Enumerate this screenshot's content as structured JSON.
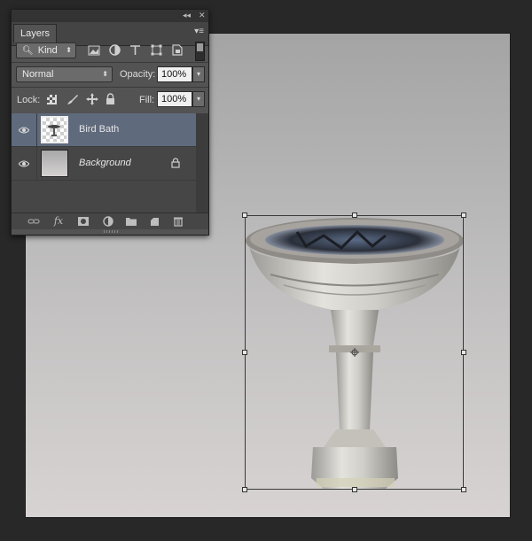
{
  "panel": {
    "tab_label": "Layers",
    "collapse_glyph": "◂◂",
    "close_glyph": "✕",
    "menu_glyph": "▾≡"
  },
  "filter": {
    "kind_label": "Kind",
    "icons": [
      "image-filter-icon",
      "adjustment-filter-icon",
      "type-filter-icon",
      "shape-filter-icon",
      "smart-object-filter-icon",
      "filter-toggle"
    ]
  },
  "blend": {
    "mode": "Normal",
    "opacity_label": "Opacity:",
    "opacity_value": "100%"
  },
  "lock": {
    "label": "Lock:",
    "icons": [
      "lock-transparent-icon",
      "lock-image-icon",
      "lock-position-icon",
      "lock-all-icon"
    ],
    "fill_label": "Fill:",
    "fill_value": "100%"
  },
  "layers": [
    {
      "name": "Bird Bath",
      "visible": true,
      "selected": true,
      "italic": false,
      "locked": false
    },
    {
      "name": "Background",
      "visible": true,
      "selected": false,
      "italic": true,
      "locked": true
    }
  ],
  "bottom_icons": [
    "link-layers-icon",
    "fx-icon",
    "add-mask-icon",
    "adjustment-layer-icon",
    "new-group-icon",
    "new-layer-icon",
    "trash-icon"
  ],
  "colors": {
    "selected_row": "#5f6a7c",
    "panel_bg": "#535353",
    "app_bg": "#282828"
  }
}
